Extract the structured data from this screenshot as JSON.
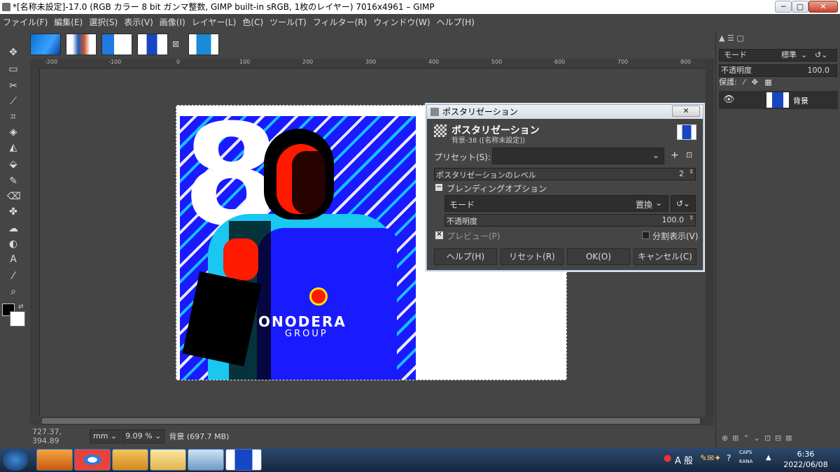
{
  "window": {
    "title": "*[名称未設定]-17.0 (RGB カラー 8 bit ガンマ整数, GIMP built-in sRGB, 1枚のレイヤー) 7016x4961 – GIMP",
    "minimize": "─",
    "maximize": "▢",
    "close": "✕"
  },
  "menubar": [
    "ファイル(F)",
    "編集(E)",
    "選択(S)",
    "表示(V)",
    "画像(I)",
    "レイヤー(L)",
    "色(C)",
    "ツール(T)",
    "フィルター(R)",
    "ウィンドウ(W)",
    "ヘルプ(H)"
  ],
  "ruler": {
    "h_ticks": [
      "-200",
      "-100",
      "0",
      "100",
      "200",
      "300",
      "400",
      "500",
      "600",
      "700",
      "800"
    ]
  },
  "image": {
    "big_number": "8",
    "sponsor_line1": "ONODERA",
    "sponsor_line2": "GROUP"
  },
  "statusbar": {
    "coords": "727.37, 394.89",
    "unit": "mm",
    "zoom": "9.09 %",
    "layer_info": "背景 (697.7 MB)"
  },
  "dock": {
    "mode_label": "モード",
    "mode_value": "標準",
    "opacity_label": "不透明度",
    "opacity_value": "100.0",
    "lock_label": "保護:",
    "layer_name": "背景"
  },
  "dialog": {
    "window_title": "ポスタリゼーション",
    "close": "✕",
    "heading": "ポスタリゼーション",
    "subheading": "背景-38 ([名称未設定])",
    "preset_label": "プリセット(S):",
    "preset_value": "",
    "levels_label": "ポスタリゼーションのレベル",
    "levels_value": "2",
    "blending_label": "ブレンディングオプション",
    "mode_label": "モード",
    "mode_value": "置換",
    "opacity_label": "不透明度",
    "opacity_value": "100.0",
    "preview_label": "プレビュー(P)",
    "split_label": "分割表示(V)",
    "buttons": {
      "help": "ヘルプ(H)",
      "reset": "リセット(R)",
      "ok": "OK(O)",
      "cancel": "キャンセル(C)"
    }
  },
  "taskbar": {
    "ime": "A 般",
    "caps": "CAPS",
    "kana": "KANA",
    "time": "6:36",
    "date": "2022/06/08"
  }
}
